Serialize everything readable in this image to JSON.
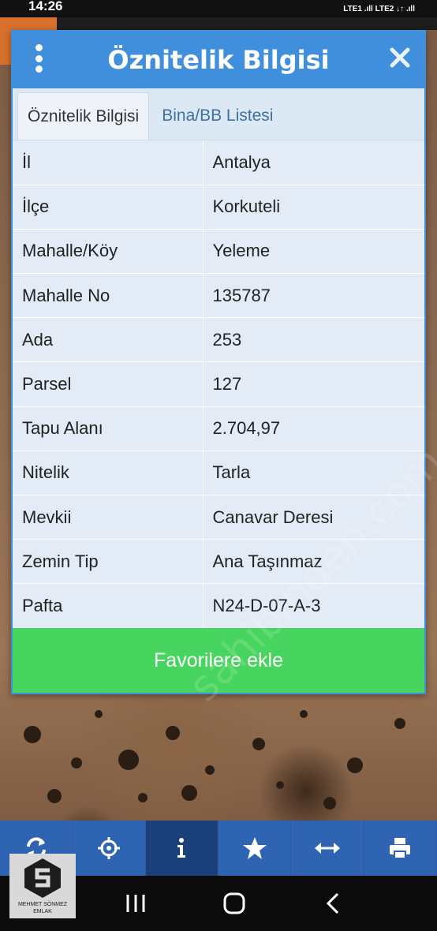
{
  "status_bar": {
    "time": "14:26",
    "signal": "LTE1 .ıll LTE2 ↓↑ .ıll"
  },
  "dialog": {
    "title": "Öznitelik Bilgisi",
    "tabs": [
      {
        "label": "Öznitelik Bilgisi",
        "active": true
      },
      {
        "label": "Bina/BB Listesi",
        "active": false
      }
    ],
    "rows": [
      {
        "key": "İl",
        "value": "Antalya"
      },
      {
        "key": "İlçe",
        "value": "Korkuteli"
      },
      {
        "key": "Mahalle/Köy",
        "value": "Yeleme"
      },
      {
        "key": "Mahalle No",
        "value": "135787"
      },
      {
        "key": "Ada",
        "value": "253"
      },
      {
        "key": "Parsel",
        "value": "127"
      },
      {
        "key": "Tapu Alanı",
        "value": "2.704,97"
      },
      {
        "key": "Nitelik",
        "value": "Tarla"
      },
      {
        "key": "Mevkii",
        "value": "Canavar Deresi"
      },
      {
        "key": "Zemin Tip",
        "value": "Ana Taşınmaz"
      },
      {
        "key": "Pafta",
        "value": "N24-D-07-A-3"
      }
    ],
    "favorite_button": "Favorilere ekle"
  },
  "toolbar": {
    "items": [
      {
        "icon": "refresh-icon"
      },
      {
        "icon": "locate-icon"
      },
      {
        "icon": "info-icon",
        "active": true
      },
      {
        "icon": "star-icon"
      },
      {
        "icon": "measure-icon"
      },
      {
        "icon": "print-icon"
      }
    ]
  },
  "navbar": {
    "items": [
      {
        "icon": "recent-apps-icon"
      },
      {
        "icon": "home-icon"
      },
      {
        "icon": "back-icon"
      }
    ]
  },
  "brand": {
    "line1": "MEHMET SÖNMEZ",
    "line2": "EMLAK"
  },
  "watermark": "sahibinden.com emlakjet.com",
  "colors": {
    "header_blue": "#3f8fdd",
    "favorite_green": "#47d45f",
    "toolbar_blue": "#2f64b3"
  }
}
